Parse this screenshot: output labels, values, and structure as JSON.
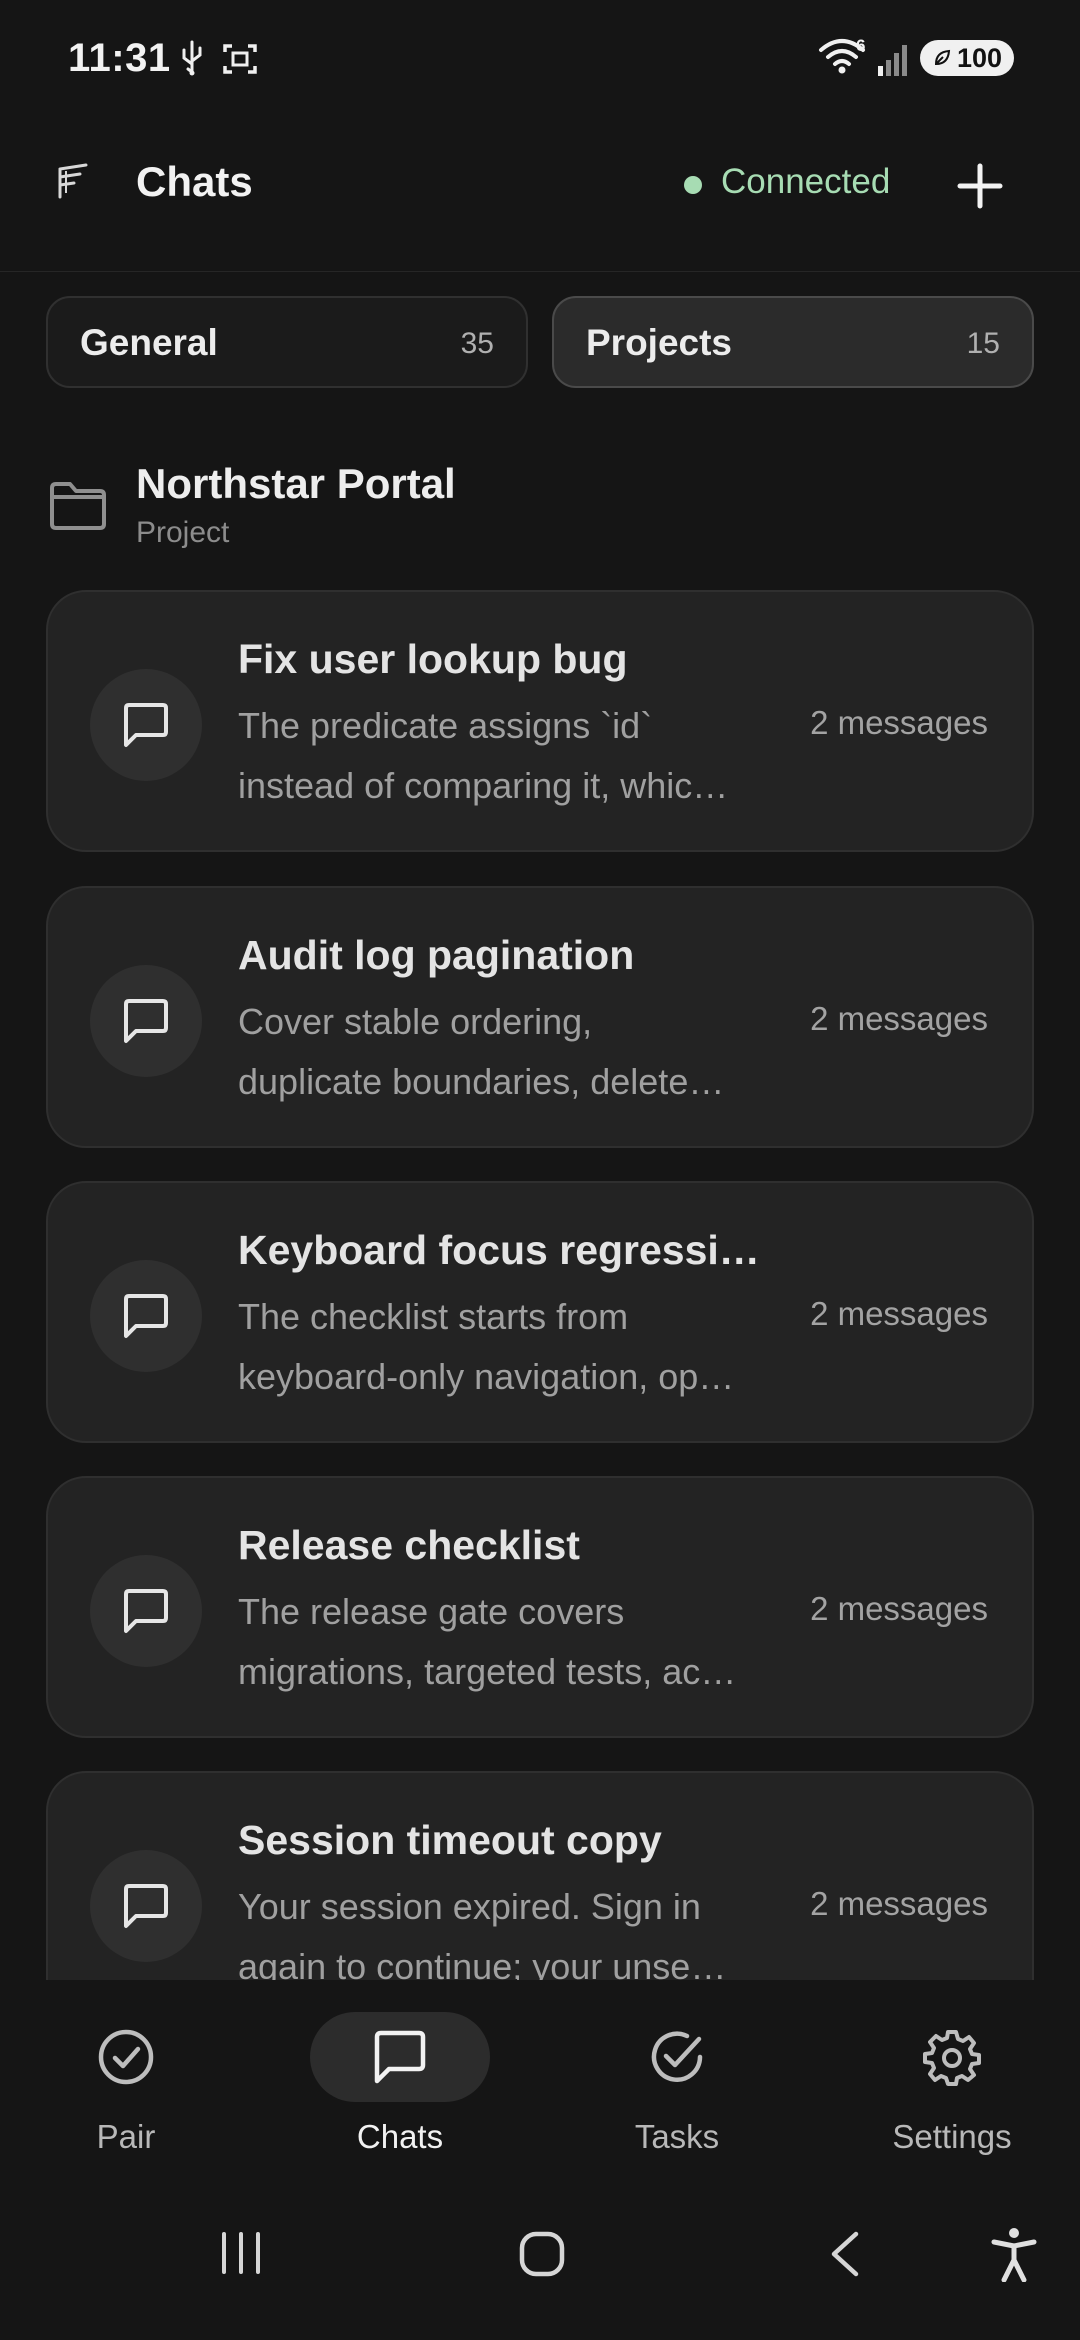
{
  "status_bar": {
    "time": "11:31",
    "network_badge": "6",
    "battery": "100"
  },
  "header": {
    "title": "Chats",
    "connection_status": "Connected",
    "connection_color": "#a7dcb3"
  },
  "segments": [
    {
      "label": "General",
      "count": "35",
      "active": false
    },
    {
      "label": "Projects",
      "count": "15",
      "active": true
    }
  ],
  "project": {
    "name": "Northstar Portal",
    "type": "Project"
  },
  "chats": [
    {
      "title": "Fix user lookup bug",
      "preview_line1": "The predicate assigns `id`",
      "preview_line2": "instead of comparing it, whic…",
      "count": "2 messages"
    },
    {
      "title": "Audit log pagination",
      "preview_line1": "Cover stable ordering,",
      "preview_line2": "duplicate boundaries, delete…",
      "count": "2 messages"
    },
    {
      "title": "Keyboard focus regressi…",
      "preview_line1": "The checklist starts from",
      "preview_line2": "keyboard-only navigation, op…",
      "count": "2 messages"
    },
    {
      "title": "Release checklist",
      "preview_line1": "The release gate covers",
      "preview_line2": "migrations, targeted tests, ac…",
      "count": "2 messages"
    },
    {
      "title": "Session timeout copy",
      "preview_line1": "Your session expired. Sign in",
      "preview_line2": "again to continue; your unse…",
      "count": "2 messages"
    }
  ],
  "bottom_nav": [
    {
      "label": "Pair",
      "icon": "check-circle-icon",
      "active": false
    },
    {
      "label": "Chats",
      "icon": "message-square-icon",
      "active": true
    },
    {
      "label": "Tasks",
      "icon": "check-circle-icon",
      "active": false
    },
    {
      "label": "Settings",
      "icon": "gear-icon",
      "active": false
    }
  ]
}
